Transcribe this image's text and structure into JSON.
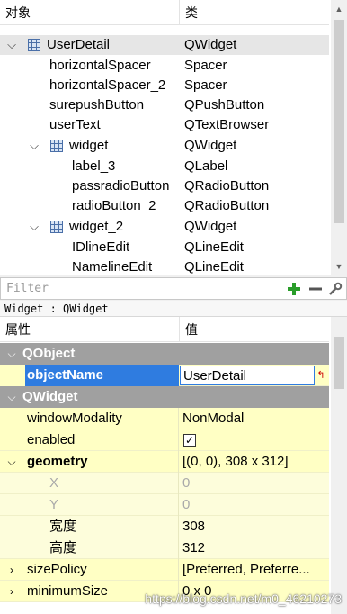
{
  "object_inspector": {
    "col_object": "对象",
    "col_class": "类",
    "rows": [
      {
        "name": "UserDetail",
        "class": "QWidget"
      },
      {
        "name": "horizontalSpacer",
        "class": "Spacer"
      },
      {
        "name": "horizontalSpacer_2",
        "class": "Spacer"
      },
      {
        "name": "surepushButton",
        "class": "QPushButton"
      },
      {
        "name": "userText",
        "class": "QTextBrowser"
      },
      {
        "name": "widget",
        "class": "QWidget"
      },
      {
        "name": "label_3",
        "class": "QLabel"
      },
      {
        "name": "passradioButton",
        "class": "QRadioButton"
      },
      {
        "name": "radioButton_2",
        "class": "QRadioButton"
      },
      {
        "name": "widget_2",
        "class": "QWidget"
      },
      {
        "name": "IDlineEdit",
        "class": "QLineEdit"
      },
      {
        "name": "NamelineEdit",
        "class": "QLineEdit"
      }
    ]
  },
  "filter": {
    "placeholder": "Filter"
  },
  "object_path": "Widget : QWidget",
  "property_editor": {
    "col_property": "属性",
    "col_value": "值",
    "section_qobject": "QObject",
    "section_qwidget": "QWidget",
    "object_name_label": "objectName",
    "object_name_value": "UserDetail",
    "rows": [
      {
        "name": "windowModality",
        "value": "NonModal"
      },
      {
        "name": "enabled",
        "value": "✓"
      },
      {
        "name": "geometry",
        "value": "[(0, 0), 308 x 312]"
      },
      {
        "name": "X",
        "value": "0"
      },
      {
        "name": "Y",
        "value": "0"
      },
      {
        "name": "宽度",
        "value": "308"
      },
      {
        "name": "高度",
        "value": "312"
      },
      {
        "name": "sizePolicy",
        "value": "[Preferred, Preferre..."
      },
      {
        "name": "minimumSize",
        "value": "0 x 0"
      }
    ]
  },
  "watermark": "https://blog.csdn.net/m0_46210273"
}
